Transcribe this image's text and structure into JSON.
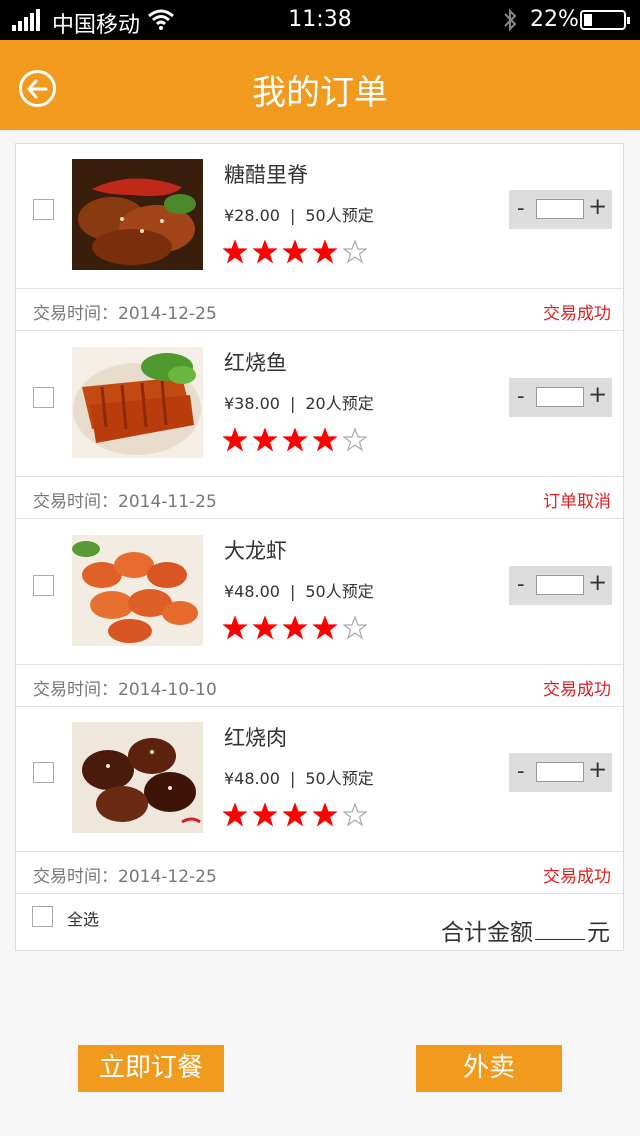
{
  "status_bar": {
    "carrier": "中国移动",
    "time": "11:38",
    "battery_percent": "22%",
    "battery_level": 0.22
  },
  "header": {
    "title": "我的订单",
    "back_icon": "back-arrow-circle-icon"
  },
  "orders": [
    {
      "name": "糖醋里脊",
      "price": "¥28.00",
      "reservations": "50人预定",
      "rating": 4,
      "rating_max": 5,
      "time_label": "交易时间：2014-12-25",
      "status": "交易成功"
    },
    {
      "name": "红烧鱼",
      "price": "¥38.00",
      "reservations": "20人预定",
      "rating": 4,
      "rating_max": 5,
      "time_label": "交易时间：2014-11-25",
      "status": "订单取消"
    },
    {
      "name": "大龙虾",
      "price": "¥48.00",
      "reservations": "50人预定",
      "rating": 4,
      "rating_max": 5,
      "time_label": "交易时间：2014-10-10",
      "status": "交易成功"
    },
    {
      "name": "红烧肉",
      "price": "¥48.00",
      "reservations": "50人预定",
      "rating": 4,
      "rating_max": 5,
      "time_label": "交易时间：2014-12-25",
      "status": "交易成功"
    }
  ],
  "qty_controls": {
    "minus": "-",
    "plus": "+"
  },
  "separator": "|",
  "summary": {
    "select_all": "全选",
    "total_label": "合计金额",
    "total_unit": "元"
  },
  "buttons": {
    "order_now": "立即订餐",
    "takeout": "外卖"
  },
  "colors": {
    "accent": "#f19a1e",
    "status_red": "#e02020",
    "star": "#ff0000"
  }
}
